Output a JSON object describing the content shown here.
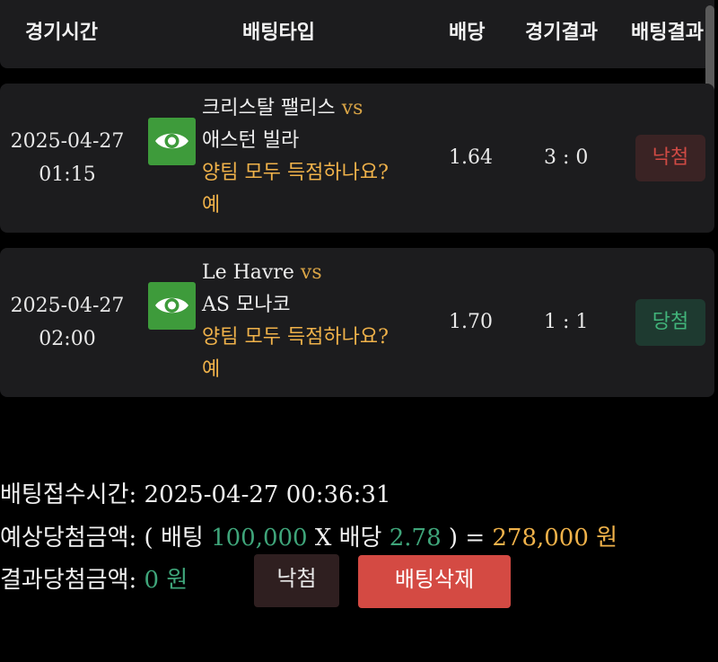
{
  "header": {
    "col_time": "경기시간",
    "col_type": "배팅타입",
    "col_odds": "배당",
    "col_game_result": "경기결과",
    "col_bet_result": "배팅결과"
  },
  "bets": [
    {
      "date": "2025-04-27",
      "time": "01:15",
      "home": "크리스탈 팰리스",
      "vs": "vs",
      "away": "애스턴 빌라",
      "question": "양팀 모두 득점하나요?",
      "pick": "예",
      "odds": "1.64",
      "score": "3 : 0",
      "result": "낙첨",
      "result_color": "#d04a44"
    },
    {
      "date": "2025-04-27",
      "time": "02:00",
      "home": "Le Havre",
      "vs": "vs",
      "away": "AS 모나코",
      "question": "양팀 모두 득점하나요?",
      "pick": "예",
      "odds": "1.70",
      "score": "1 : 1",
      "result": "당첨",
      "result_color": "#41b47a"
    }
  ],
  "summary": {
    "received_label": "배팅접수시간:",
    "received_value": "2025-04-27 00:36:31",
    "expected_label": "예상당첨금액:",
    "expected_open": "( 배팅",
    "stake": "100,000",
    "times": "X 배당",
    "total_odds": "2.78",
    "expected_close": ") =",
    "expected_amount": "278,000",
    "expected_unit": "원",
    "won_label": "결과당첨금액:",
    "won_amount": "0 원"
  },
  "actions": {
    "status_label": "낙첨",
    "delete_label": "배팅삭제"
  },
  "icons": {
    "view": "eye-icon"
  },
  "colors": {
    "background": "#000000",
    "card": "#1c1c1e",
    "icon_green": "#3e9b3b",
    "question_amber": "#f0b24a",
    "money_green": "#3fa57a",
    "delete_red": "#d44a43"
  }
}
